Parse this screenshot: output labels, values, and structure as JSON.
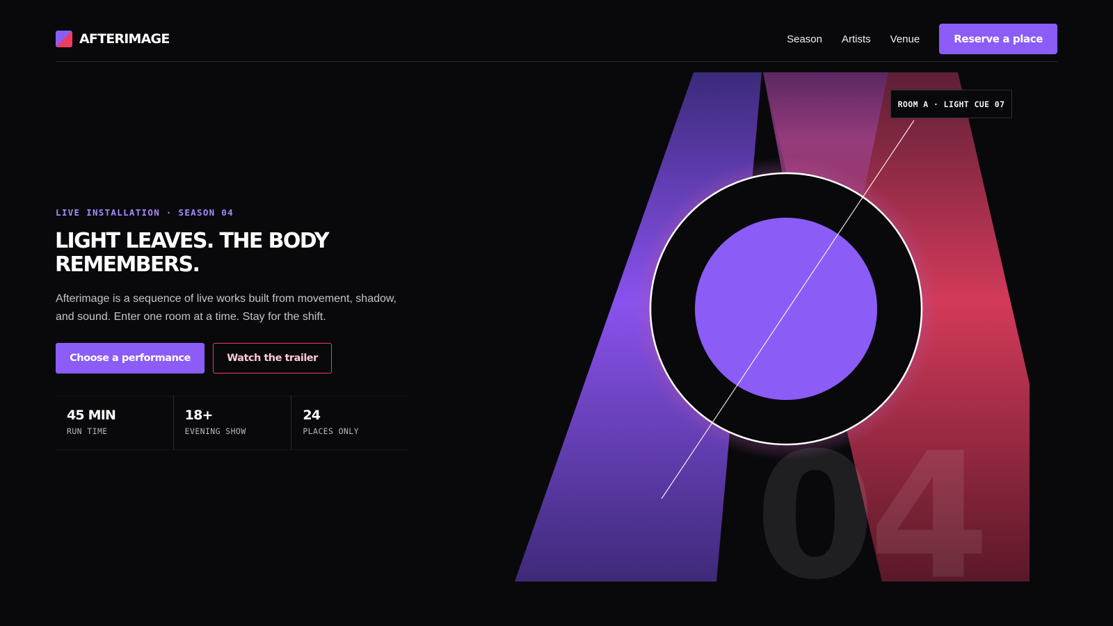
{
  "brand": {
    "name": "AFTERIMAGE",
    "icon": "afterimage-logo-icon"
  },
  "nav": {
    "links": [
      "Season",
      "Artists",
      "Venue"
    ],
    "cta_label": "Reserve a place"
  },
  "hero": {
    "eyebrow": "LIVE INSTALLATION · SEASON 04",
    "headline": "LIGHT LEAVES. THE BODY REMEMBERS.",
    "lede": "Afterimage is a sequence of live works built from movement, shadow, and sound. Enter one room at a time. Stay for the shift.",
    "primary_cta": "Choose a performance",
    "secondary_cta": "Watch the trailer"
  },
  "stats": [
    {
      "value": "45 MIN",
      "label": "RUN TIME"
    },
    {
      "value": "18+",
      "label": "EVENING SHOW"
    },
    {
      "value": "24",
      "label": "PLACES ONLY"
    }
  ],
  "art": {
    "cue_label": "ROOM A · LIGHT CUE 07",
    "season_number": "04"
  },
  "colors": {
    "background": "#09090c",
    "accent_violet": "#8b5cf6",
    "accent_red": "#ef3b5f",
    "eyebrow": "#a78bfa"
  }
}
